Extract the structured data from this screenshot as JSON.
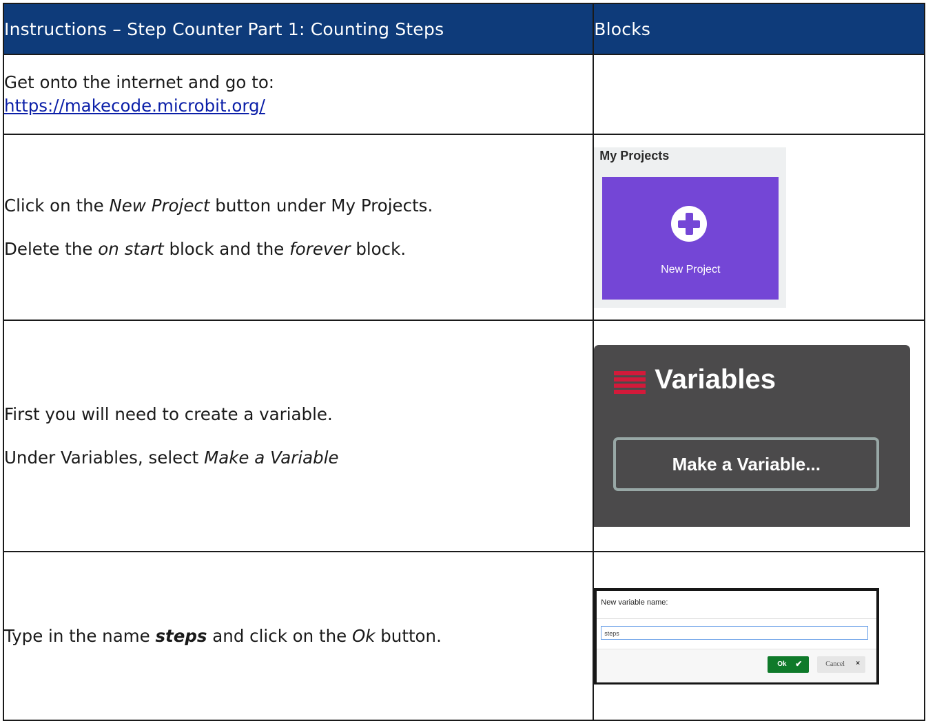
{
  "header": {
    "instructions": "Instructions – Step Counter Part 1: Counting Steps",
    "blocks": "Blocks"
  },
  "row1": {
    "line1": "Get onto the internet and go to:",
    "link": "https://makecode.microbit.org/"
  },
  "row2": {
    "l1_a": "Click on the ",
    "l1_em": "New Project",
    "l1_b": " button under My Projects.",
    "l2_a": "Delete the ",
    "l2_em1": "on start",
    "l2_b": " block and the ",
    "l2_em2": "forever",
    "l2_c": " block.",
    "image": {
      "title": "My Projects",
      "card_label": "New Project",
      "card_color": "#7446d6",
      "icon": "plus-circle-icon"
    }
  },
  "row3": {
    "l1": "First you will need to create a variable.",
    "l2_a": "Under Variables, select ",
    "l2_em": "Make a Variable",
    "image": {
      "title": "Variables",
      "button": "Make a Variable...",
      "icon": "variables-icon",
      "icon_color": "#d31a3a",
      "background": "#4b4a4b"
    }
  },
  "row4": {
    "a": "Type in the name ",
    "bold": "steps",
    "b": " and click on the ",
    "em": "Ok",
    "c": " button.",
    "image": {
      "title": "New variable name:",
      "input_value": "steps",
      "ok": "Ok",
      "cancel": "Cancel",
      "ok_color": "#0f7a2a"
    }
  },
  "colors": {
    "header_bg": "#0e3b7a",
    "link": "#0b1fa8"
  }
}
